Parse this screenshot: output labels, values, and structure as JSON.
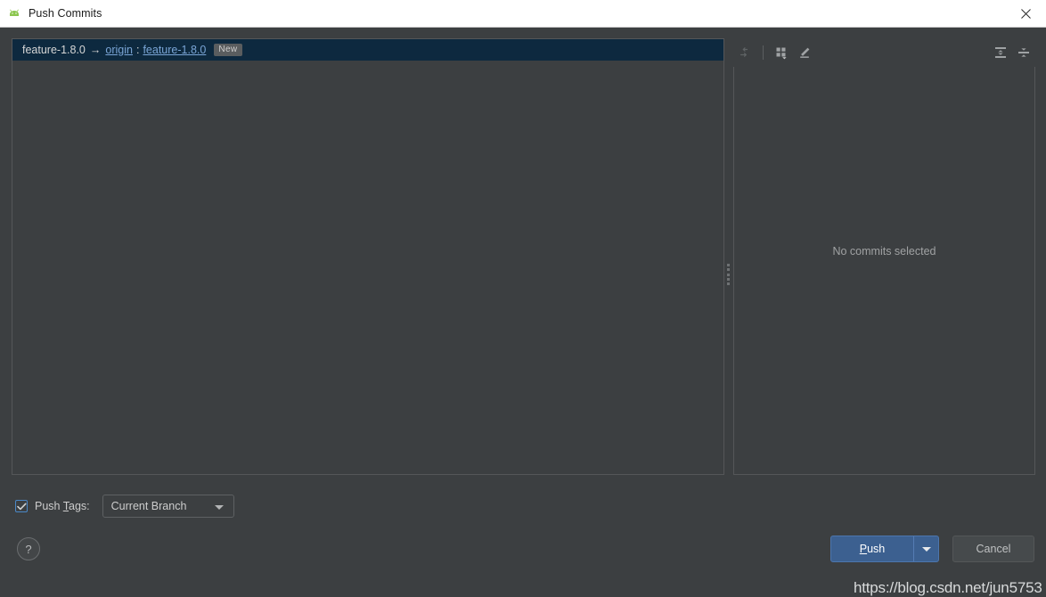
{
  "window": {
    "title": "Push Commits",
    "app_icon": "android-icon",
    "close_icon": "close-icon"
  },
  "commits_panel": {
    "branch_row": {
      "source_branch": "feature-1.8.0",
      "arrow": "→",
      "remote": "origin",
      "separator": ":",
      "target_branch": "feature-1.8.0",
      "badge": "New"
    }
  },
  "details_panel": {
    "empty_message": "No commits selected",
    "toolbar": {
      "revert_icon": "revert-arrow-icon",
      "group_by_icon": "group-by-icon",
      "edit_icon": "pencil-edit-icon",
      "expand_all_icon": "expand-all-icon",
      "collapse_all_icon": "collapse-all-icon"
    }
  },
  "options": {
    "push_tags_checked": true,
    "push_tags_label_prefix": "Push ",
    "push_tags_mnemonic": "T",
    "push_tags_label_suffix": "ags:",
    "tags_mode_value": "Current Branch"
  },
  "footer": {
    "help_label": "?",
    "push_mnemonic": "P",
    "push_label_rest": "ush",
    "cancel_label": "Cancel",
    "watermark": "https://blog.csdn.net/jun5753"
  },
  "colors": {
    "dialog_bg": "#3c3f41",
    "selection_bg": "#0d293f",
    "link": "#7aa5d6",
    "accent_button": "#3c6090",
    "checkbox_border": "#4a88c7"
  }
}
